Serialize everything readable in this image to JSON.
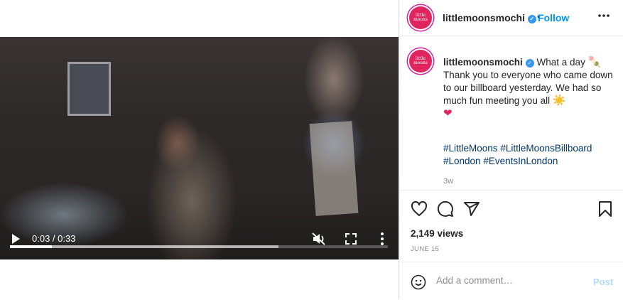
{
  "video": {
    "time": "0:03 / 0:33",
    "progress_played": 0.11,
    "progress_buffered": 0.71
  },
  "header": {
    "avatar_text": "little moons",
    "username": "littlemoonsmochi",
    "separator": "•",
    "follow_label": "Follow"
  },
  "caption": {
    "username": "littlemoonsmochi",
    "lines": [
      "What a day",
      "Thank you to everyone who came down to our billboard yesterday. We had so much fun meeting you all"
    ],
    "emojis": [
      "mochi-skewer-icon",
      "sun-icon",
      "red-heart-icon"
    ],
    "hashtags": [
      "#LittleMoons",
      "#LittleMoonsBillboard",
      "#London",
      "#EventsInLondon"
    ],
    "age": "3w"
  },
  "stats": {
    "views": "2,149 views",
    "date": "JUNE 15"
  },
  "comment": {
    "placeholder": "Add a comment…",
    "post_label": "Post"
  },
  "colors": {
    "accent": "#0095f6",
    "hashtag": "#00376b",
    "muted": "#8e8e8e",
    "post_disabled": "#b3dbff",
    "avatar_bg": "#e0245e"
  }
}
